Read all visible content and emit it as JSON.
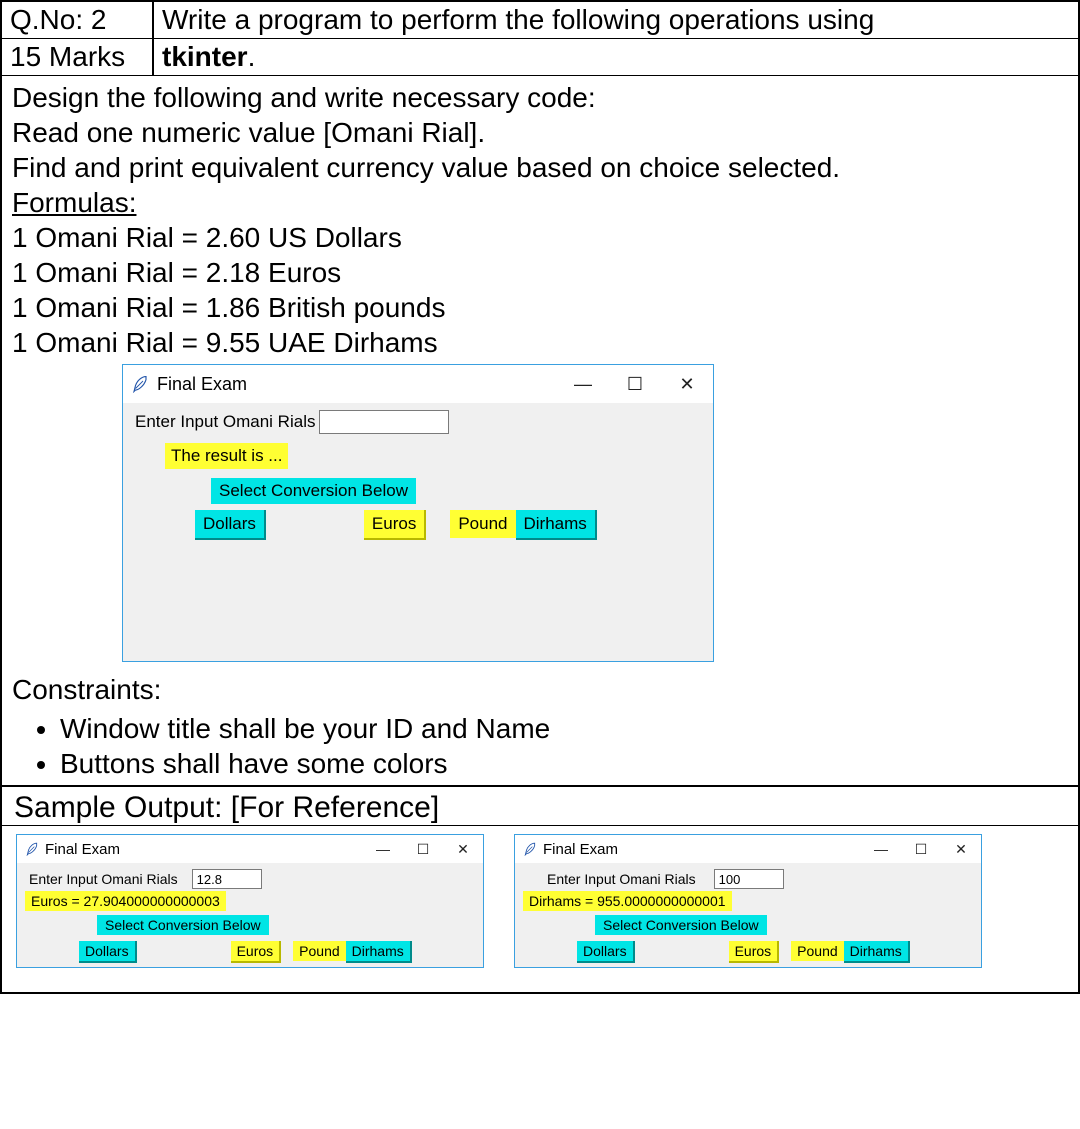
{
  "header": {
    "qno": "Q.No: 2",
    "marks": "15 Marks",
    "prompt_line1": "Write a program to perform the following operations using",
    "prompt_line2_prefix": "",
    "prompt_bold": "tkinter",
    "prompt_line2_suffix": "."
  },
  "body": {
    "line1": "Design the following and write necessary code:",
    "line2": "Read one numeric value [Omani Rial].",
    "line3": "Find and print equivalent currency value based on choice selected.",
    "formulas_heading": "Formulas:",
    "f1": "1 Omani Rial = 2.60 US Dollars",
    "f2": "1 Omani Rial = 2.18 Euros",
    "f3": "1 Omani Rial = 1.86 British pounds",
    "f4": "1 Omani Rial = 9.55 UAE Dirhams"
  },
  "tk_main": {
    "title": "Final Exam",
    "input_label": "Enter Input Omani Rials",
    "input_value": "",
    "result": "The result is ...",
    "select_label": "Select Conversion Below",
    "btn_dollars": "Dollars",
    "btn_euros": "Euros",
    "btn_pound": "Pound",
    "btn_dirhams": "Dirhams"
  },
  "constraints": {
    "heading": "Constraints:",
    "c1": "Window title shall be your ID and Name",
    "c2": "Buttons shall have some colors"
  },
  "sample": {
    "heading": "Sample Output: [For Reference]",
    "left": {
      "title": "Final Exam",
      "input_label": "Enter Input Omani Rials",
      "input_value": "12.8",
      "result": "Euros = 27.904000000000003",
      "select_label": "Select Conversion Below",
      "btn_dollars": "Dollars",
      "btn_euros": "Euros",
      "btn_pound": "Pound",
      "btn_dirhams": "Dirhams"
    },
    "right": {
      "title": "Final Exam",
      "input_label": "Enter Input Omani Rials",
      "input_value": "100",
      "result": "Dirhams = 955.0000000000001",
      "select_label": "Select Conversion Below",
      "btn_dollars": "Dollars",
      "btn_euros": "Euros",
      "btn_pound": "Pound",
      "btn_dirhams": "Dirhams"
    }
  },
  "win": {
    "min": "—",
    "max": "▢",
    "close": "✕"
  }
}
